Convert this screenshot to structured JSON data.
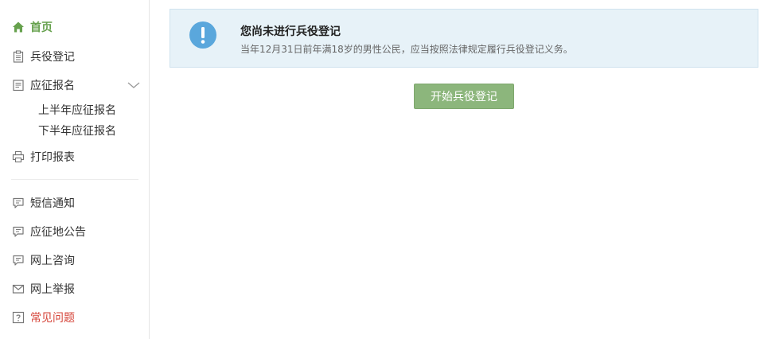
{
  "sidebar": {
    "items": [
      {
        "label": "首页",
        "icon": "home-icon",
        "state": "active"
      },
      {
        "label": "兵役登记",
        "icon": "clipboard-icon"
      },
      {
        "label": "应征报名",
        "icon": "document-icon",
        "expanded": true,
        "children": [
          {
            "label": "上半年应征报名"
          },
          {
            "label": "下半年应征报名"
          }
        ]
      },
      {
        "label": "打印报表",
        "icon": "printer-icon"
      },
      {
        "label": "短信通知",
        "icon": "chat-icon"
      },
      {
        "label": "应征地公告",
        "icon": "chat-icon"
      },
      {
        "label": "网上咨询",
        "icon": "chat-icon"
      },
      {
        "label": "网上举报",
        "icon": "mail-icon"
      },
      {
        "label": "常见问题",
        "icon": "question-icon",
        "state": "highlight"
      }
    ]
  },
  "notice": {
    "icon": "exclamation-icon",
    "title": "您尚未进行兵役登记",
    "text": "当年12月31日前年满18岁的男性公民，应当按照法律规定履行兵役登记义务。"
  },
  "actions": {
    "start_label": "开始兵役登记"
  },
  "colors": {
    "active_nav": "#66a14d",
    "highlight_nav": "#d6453a",
    "button": "#8cb67c",
    "notice_bg": "#e7f2f8",
    "notice_icon": "#5aa7dc"
  }
}
